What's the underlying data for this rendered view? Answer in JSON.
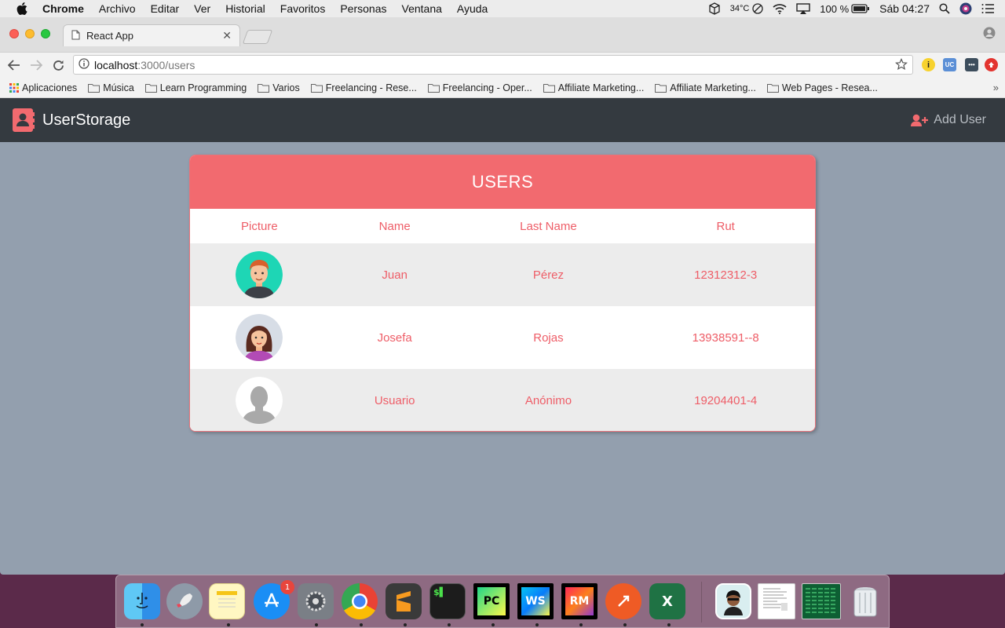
{
  "menubar": {
    "items": [
      "Chrome",
      "Archivo",
      "Editar",
      "Ver",
      "Historial",
      "Favoritos",
      "Personas",
      "Ventana",
      "Ayuda"
    ],
    "temperature": "34°C",
    "battery": "100 %",
    "clock": "Sáb 04:27"
  },
  "browser": {
    "tab_title": "React App",
    "url_host": "localhost",
    "url_path": ":3000/users",
    "bookmarks": [
      "Aplicaciones",
      "Música",
      "Learn Programming",
      "Varios",
      "Freelancing - Rese...",
      "Freelancing - Oper...",
      "Affiliate Marketing...",
      "Affiliate Marketing...",
      "Web Pages - Resea..."
    ],
    "ext_uc_label": "UC"
  },
  "app": {
    "brand": "UserStorage",
    "add_user": "Add User",
    "card_title": "USERS",
    "columns": [
      "Picture",
      "Name",
      "Last Name",
      "Rut"
    ],
    "users": [
      {
        "name": "Juan",
        "last_name": "Pérez",
        "rut": "12312312-3",
        "avatar": "male-avatar"
      },
      {
        "name": "Josefa",
        "last_name": "Rojas",
        "rut": "13938591--8",
        "avatar": "female-avatar"
      },
      {
        "name": "Usuario",
        "last_name": "Anónimo",
        "rut": "19204401-4",
        "avatar": "anonymous-avatar"
      }
    ],
    "colors": {
      "accent": "#f26a6f",
      "text_accent": "#ee5d67",
      "navbar": "#343a40",
      "background": "#939fae"
    }
  },
  "dock": {
    "app_store_badge": "1",
    "labels": {
      "pycharm": "PC",
      "webstorm": "WS",
      "rubymine": "RM",
      "excel": "X"
    }
  }
}
